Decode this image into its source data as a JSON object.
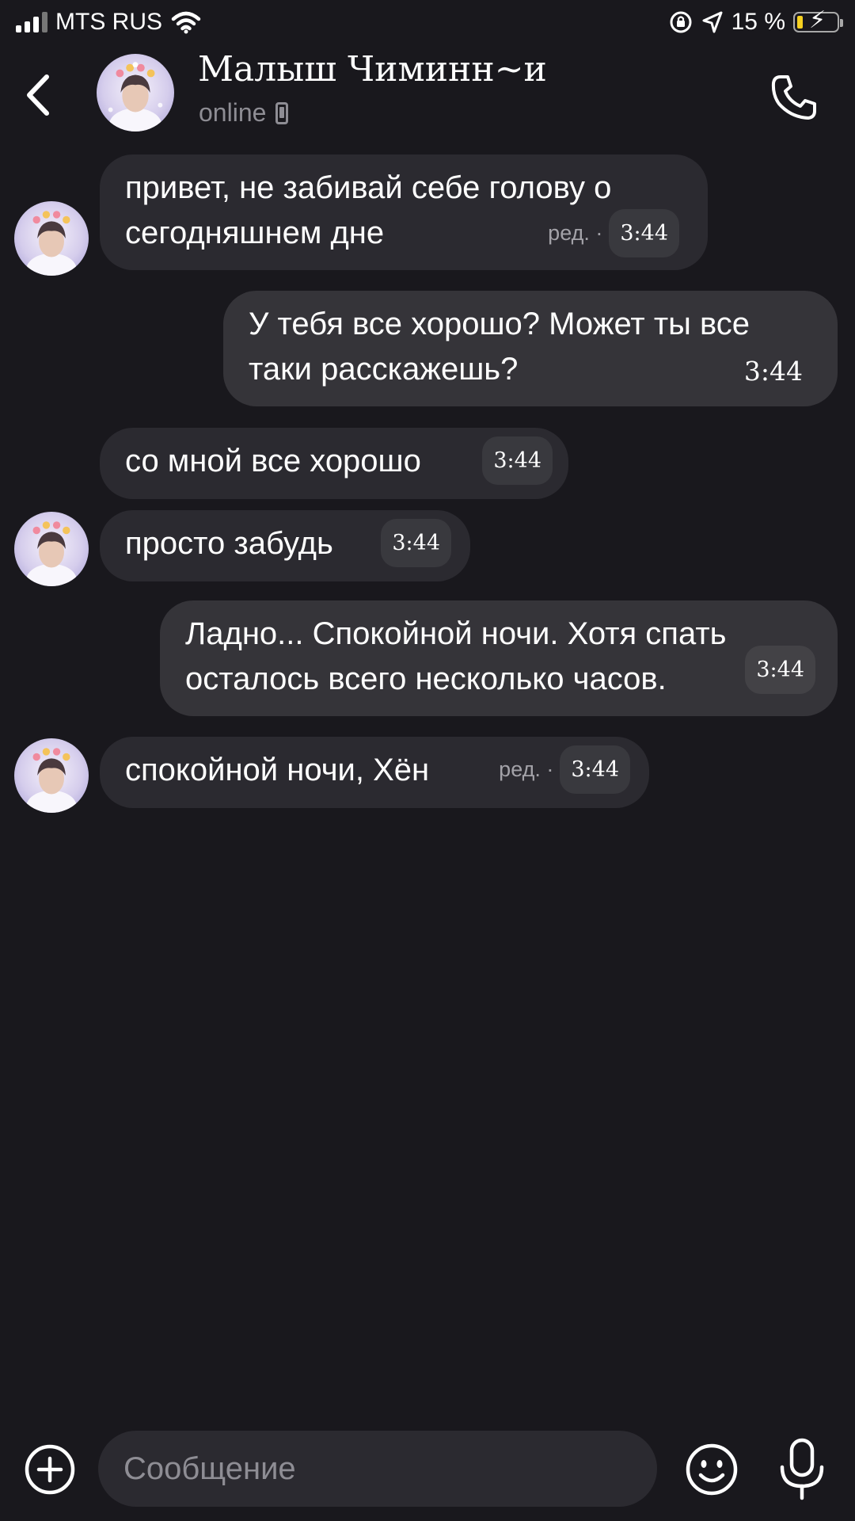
{
  "status_bar": {
    "carrier": "MTS RUS",
    "battery_percent": "15 %",
    "battery_level": 0.15,
    "colors": {
      "battery_fill": "#f5d020"
    }
  },
  "header": {
    "back_icon": "chevron-left-icon",
    "contact_name": "Малыш Чиминн~и",
    "status": "online",
    "status_icon": "mobile-device-icon",
    "call_icon": "phone-icon"
  },
  "messages": [
    {
      "direction": "in",
      "text_line1": "привет, не забивай себе голову о",
      "text_line2": "сегодняшнем дне",
      "edited": "ред. ·",
      "time": "3:44"
    },
    {
      "direction": "out",
      "text_line1": "У тебя все хорошо? Может ты все",
      "text_line2": "таки расскажешь?",
      "time": "3:44"
    },
    {
      "direction": "in",
      "text": "со мной все хорошо",
      "time": "3:44"
    },
    {
      "direction": "in",
      "text": "просто забудь",
      "time": "3:44"
    },
    {
      "direction": "out",
      "text_line1": "Ладно... Спокойной ночи. Хотя спать",
      "text_line2": "осталось всего несколько часов.",
      "time": "3:44"
    },
    {
      "direction": "in",
      "text": "спокойной ночи, Хён",
      "edited": "ред. ·",
      "time": "3:44"
    }
  ],
  "input_bar": {
    "placeholder": "Сообщение",
    "value": "",
    "attach_icon": "plus-circle-icon",
    "emoji_icon": "smiley-icon",
    "mic_icon": "microphone-icon"
  },
  "colors": {
    "background": "#19181d",
    "incoming_bubble": "#2b2a30",
    "outgoing_bubble": "#353439",
    "secondary_text": "#8e8d94"
  }
}
